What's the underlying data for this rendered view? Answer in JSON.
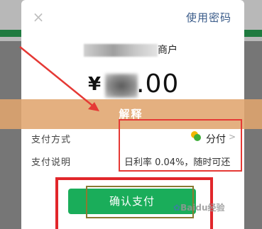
{
  "header": {
    "close_symbol": "×",
    "use_password": "使用密码"
  },
  "merchant": {
    "suffix": "商户"
  },
  "amount": {
    "currency": "¥",
    "visible_part": ".00"
  },
  "banner": {
    "text": "解释"
  },
  "rows": {
    "method_label": "支付方式",
    "method_value": "分付",
    "desc_label": "支付说明",
    "desc_value": "日利率 0.04%，随时可还"
  },
  "pay_button": {
    "label": "确认支付"
  },
  "watermark": {
    "text": "Baidu经验"
  },
  "colors": {
    "accent_green": "#1aad5a",
    "annotation_red": "#e53935",
    "banner": "#e0a56e"
  }
}
